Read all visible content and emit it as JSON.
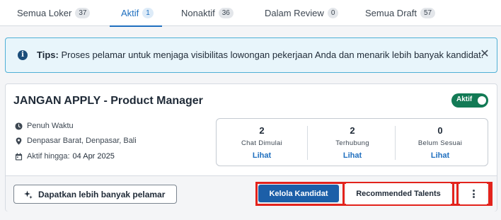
{
  "tabs": [
    {
      "label": "Semua Loker",
      "count": "37"
    },
    {
      "label": "Aktif",
      "count": "1"
    },
    {
      "label": "Nonaktif",
      "count": "36"
    },
    {
      "label": "Dalam Review",
      "count": "0"
    },
    {
      "label": "Semua Draft",
      "count": "57"
    }
  ],
  "active_tab": "Aktif",
  "tips": {
    "icon": "info-icon",
    "label": "Tips:",
    "text": "Proses pelamar untuk menjaga visibilitas lowongan pekerjaan Anda dan menarik lebih banyak kandidat."
  },
  "job": {
    "title": "JANGAN APPLY - Product Manager",
    "status_label": "Aktif",
    "status_on": true,
    "employment_type": "Penuh Waktu",
    "location": "Denpasar Barat, Denpasar, Bali",
    "active_until_label": "Aktif hingga:",
    "active_until_date": "04 Apr 2025",
    "stats": [
      {
        "value": "2",
        "label": "Chat Dimulai",
        "link": "Lihat"
      },
      {
        "value": "2",
        "label": "Terhubung",
        "link": "Lihat"
      },
      {
        "value": "0",
        "label": "Belum Sesuai",
        "link": "Lihat"
      }
    ]
  },
  "actions": {
    "more_applicants": "Dapatkan lebih banyak pelamar",
    "manage_candidates": "Kelola Kandidat",
    "recommended_talents": "Recommended Talents"
  },
  "colors": {
    "primary": "#1f6fbf",
    "active_toggle": "#127a55",
    "highlight": "#e3231c",
    "tips_bg": "#e8f5fb"
  }
}
